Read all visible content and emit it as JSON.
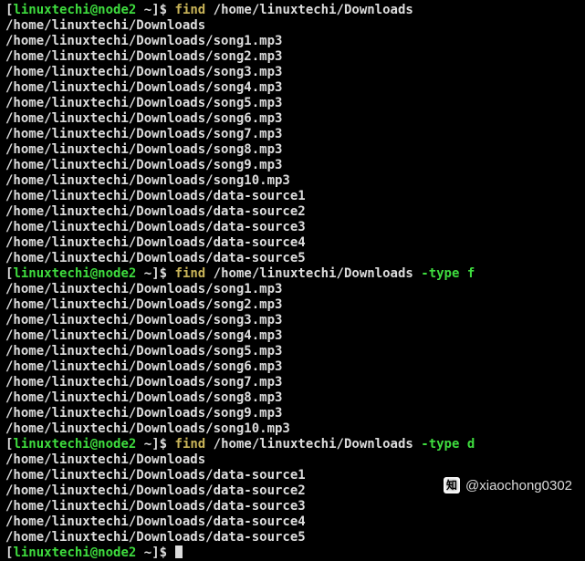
{
  "prompt": {
    "user": "linuxtechi",
    "at": "@",
    "host": "node2",
    "cwd": "~",
    "open": "[",
    "close": "]",
    "dollar": "$"
  },
  "commands": {
    "c1": {
      "find": "find",
      "path": "/home/linuxtechi/Downloads"
    },
    "c2": {
      "find": "find",
      "path": "/home/linuxtechi/Downloads",
      "flag": "-type",
      "val": "f"
    },
    "c3": {
      "find": "find",
      "path": "/home/linuxtechi/Downloads",
      "flag": "-type",
      "val": "d"
    }
  },
  "out1": {
    "l0": "/home/linuxtechi/Downloads",
    "l1": "/home/linuxtechi/Downloads/song1.mp3",
    "l2": "/home/linuxtechi/Downloads/song2.mp3",
    "l3": "/home/linuxtechi/Downloads/song3.mp3",
    "l4": "/home/linuxtechi/Downloads/song4.mp3",
    "l5": "/home/linuxtechi/Downloads/song5.mp3",
    "l6": "/home/linuxtechi/Downloads/song6.mp3",
    "l7": "/home/linuxtechi/Downloads/song7.mp3",
    "l8": "/home/linuxtechi/Downloads/song8.mp3",
    "l9": "/home/linuxtechi/Downloads/song9.mp3",
    "l10": "/home/linuxtechi/Downloads/song10.mp3",
    "l11": "/home/linuxtechi/Downloads/data-source1",
    "l12": "/home/linuxtechi/Downloads/data-source2",
    "l13": "/home/linuxtechi/Downloads/data-source3",
    "l14": "/home/linuxtechi/Downloads/data-source4",
    "l15": "/home/linuxtechi/Downloads/data-source5"
  },
  "out2": {
    "l0": "/home/linuxtechi/Downloads/song1.mp3",
    "l1": "/home/linuxtechi/Downloads/song2.mp3",
    "l2": "/home/linuxtechi/Downloads/song3.mp3",
    "l3": "/home/linuxtechi/Downloads/song4.mp3",
    "l4": "/home/linuxtechi/Downloads/song5.mp3",
    "l5": "/home/linuxtechi/Downloads/song6.mp3",
    "l6": "/home/linuxtechi/Downloads/song7.mp3",
    "l7": "/home/linuxtechi/Downloads/song8.mp3",
    "l8": "/home/linuxtechi/Downloads/song9.mp3",
    "l9": "/home/linuxtechi/Downloads/song10.mp3"
  },
  "out3": {
    "l0": "/home/linuxtechi/Downloads",
    "l1": "/home/linuxtechi/Downloads/data-source1",
    "l2": "/home/linuxtechi/Downloads/data-source2",
    "l3": "/home/linuxtechi/Downloads/data-source3",
    "l4": "/home/linuxtechi/Downloads/data-source4",
    "l5": "/home/linuxtechi/Downloads/data-source5"
  },
  "watermark": {
    "icon": "知",
    "handle": "@xiaochong0302"
  }
}
